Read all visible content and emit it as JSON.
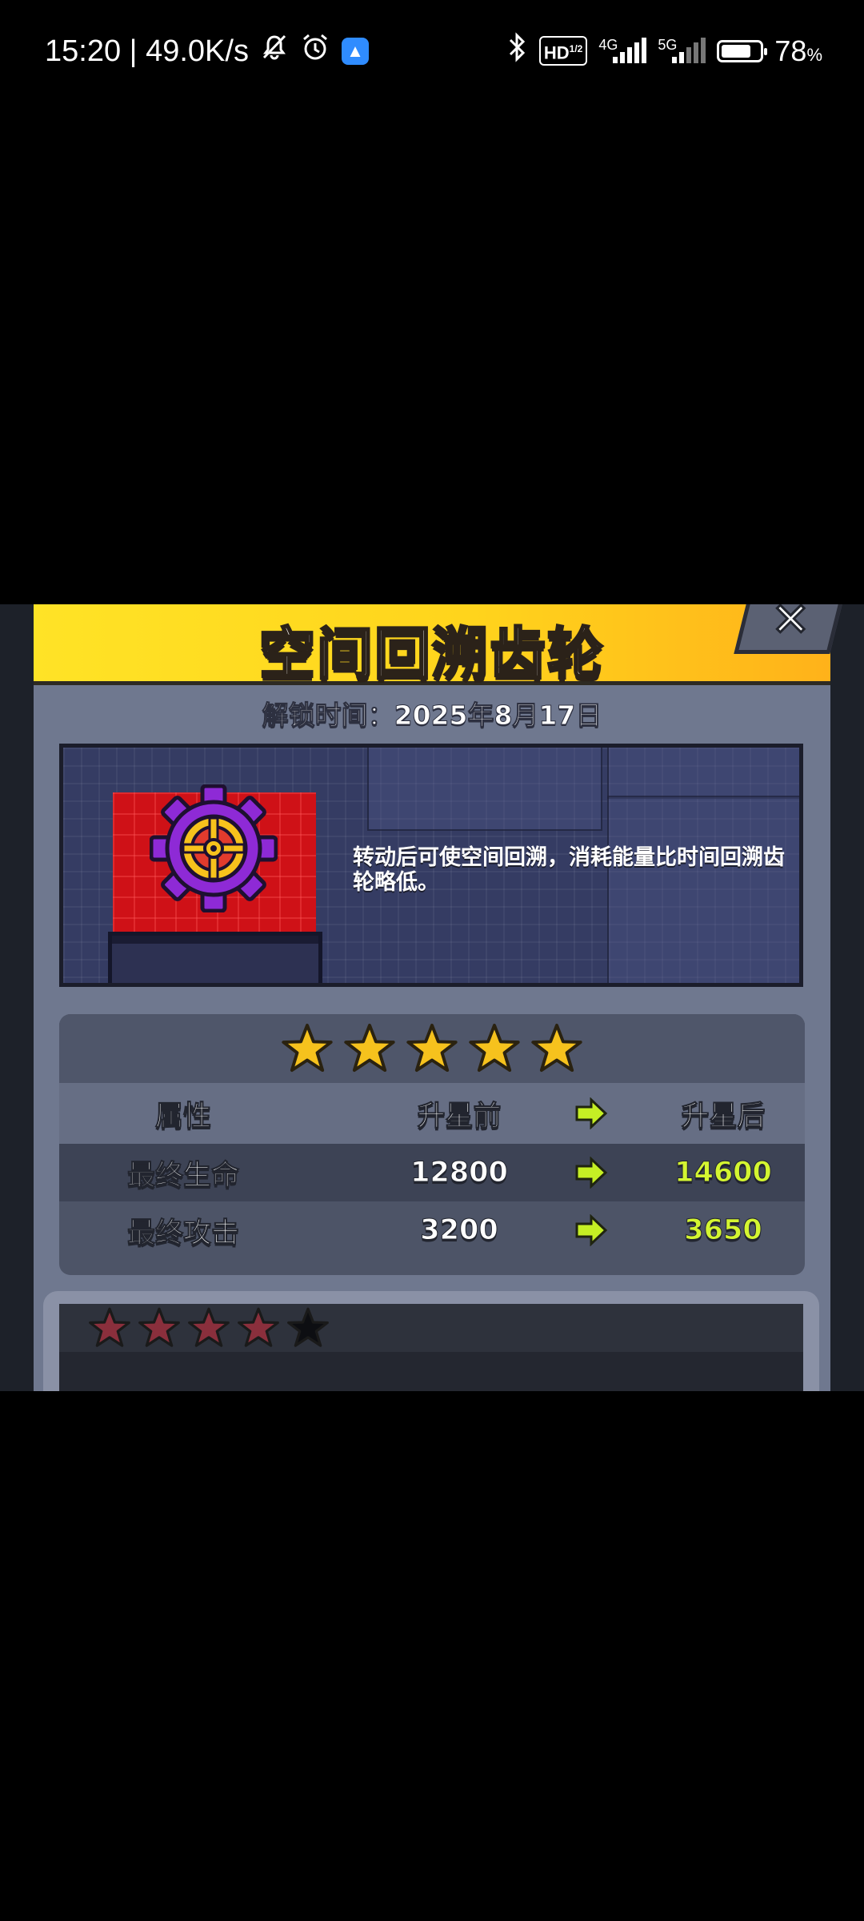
{
  "status_bar": {
    "time_speed": "15:20 | 49.0K/s",
    "hd_label": "HD",
    "hd_sub": "1/2",
    "sig1_label": "4G",
    "sig2_label": "5G",
    "battery_text": "78",
    "battery_unit": "%",
    "battery_level": 0.78
  },
  "dialog": {
    "title": "空间回溯齿轮",
    "close_label": "✕",
    "unlock_text": "解锁时间：2025年8月17日",
    "description": "转动后可使空间回溯，消耗能量比时间回溯齿轮略低。",
    "stars_total": 5,
    "stars_filled": 5,
    "table": {
      "headers": [
        "属性",
        "升星前",
        "升星后"
      ],
      "rows": [
        {
          "attr": "最终生命",
          "before": "12800",
          "after": "14600"
        },
        {
          "attr": "最终攻击",
          "before": "3200",
          "after": "3650"
        }
      ]
    },
    "next_level_stars_filled": 4,
    "next_level_stars_total": 5
  },
  "colors": {
    "header_yellow": "#ffd41c",
    "panel_gray": "#6f788f",
    "value_green": "#d4f531",
    "gear_purple": "#8e2ad6"
  }
}
